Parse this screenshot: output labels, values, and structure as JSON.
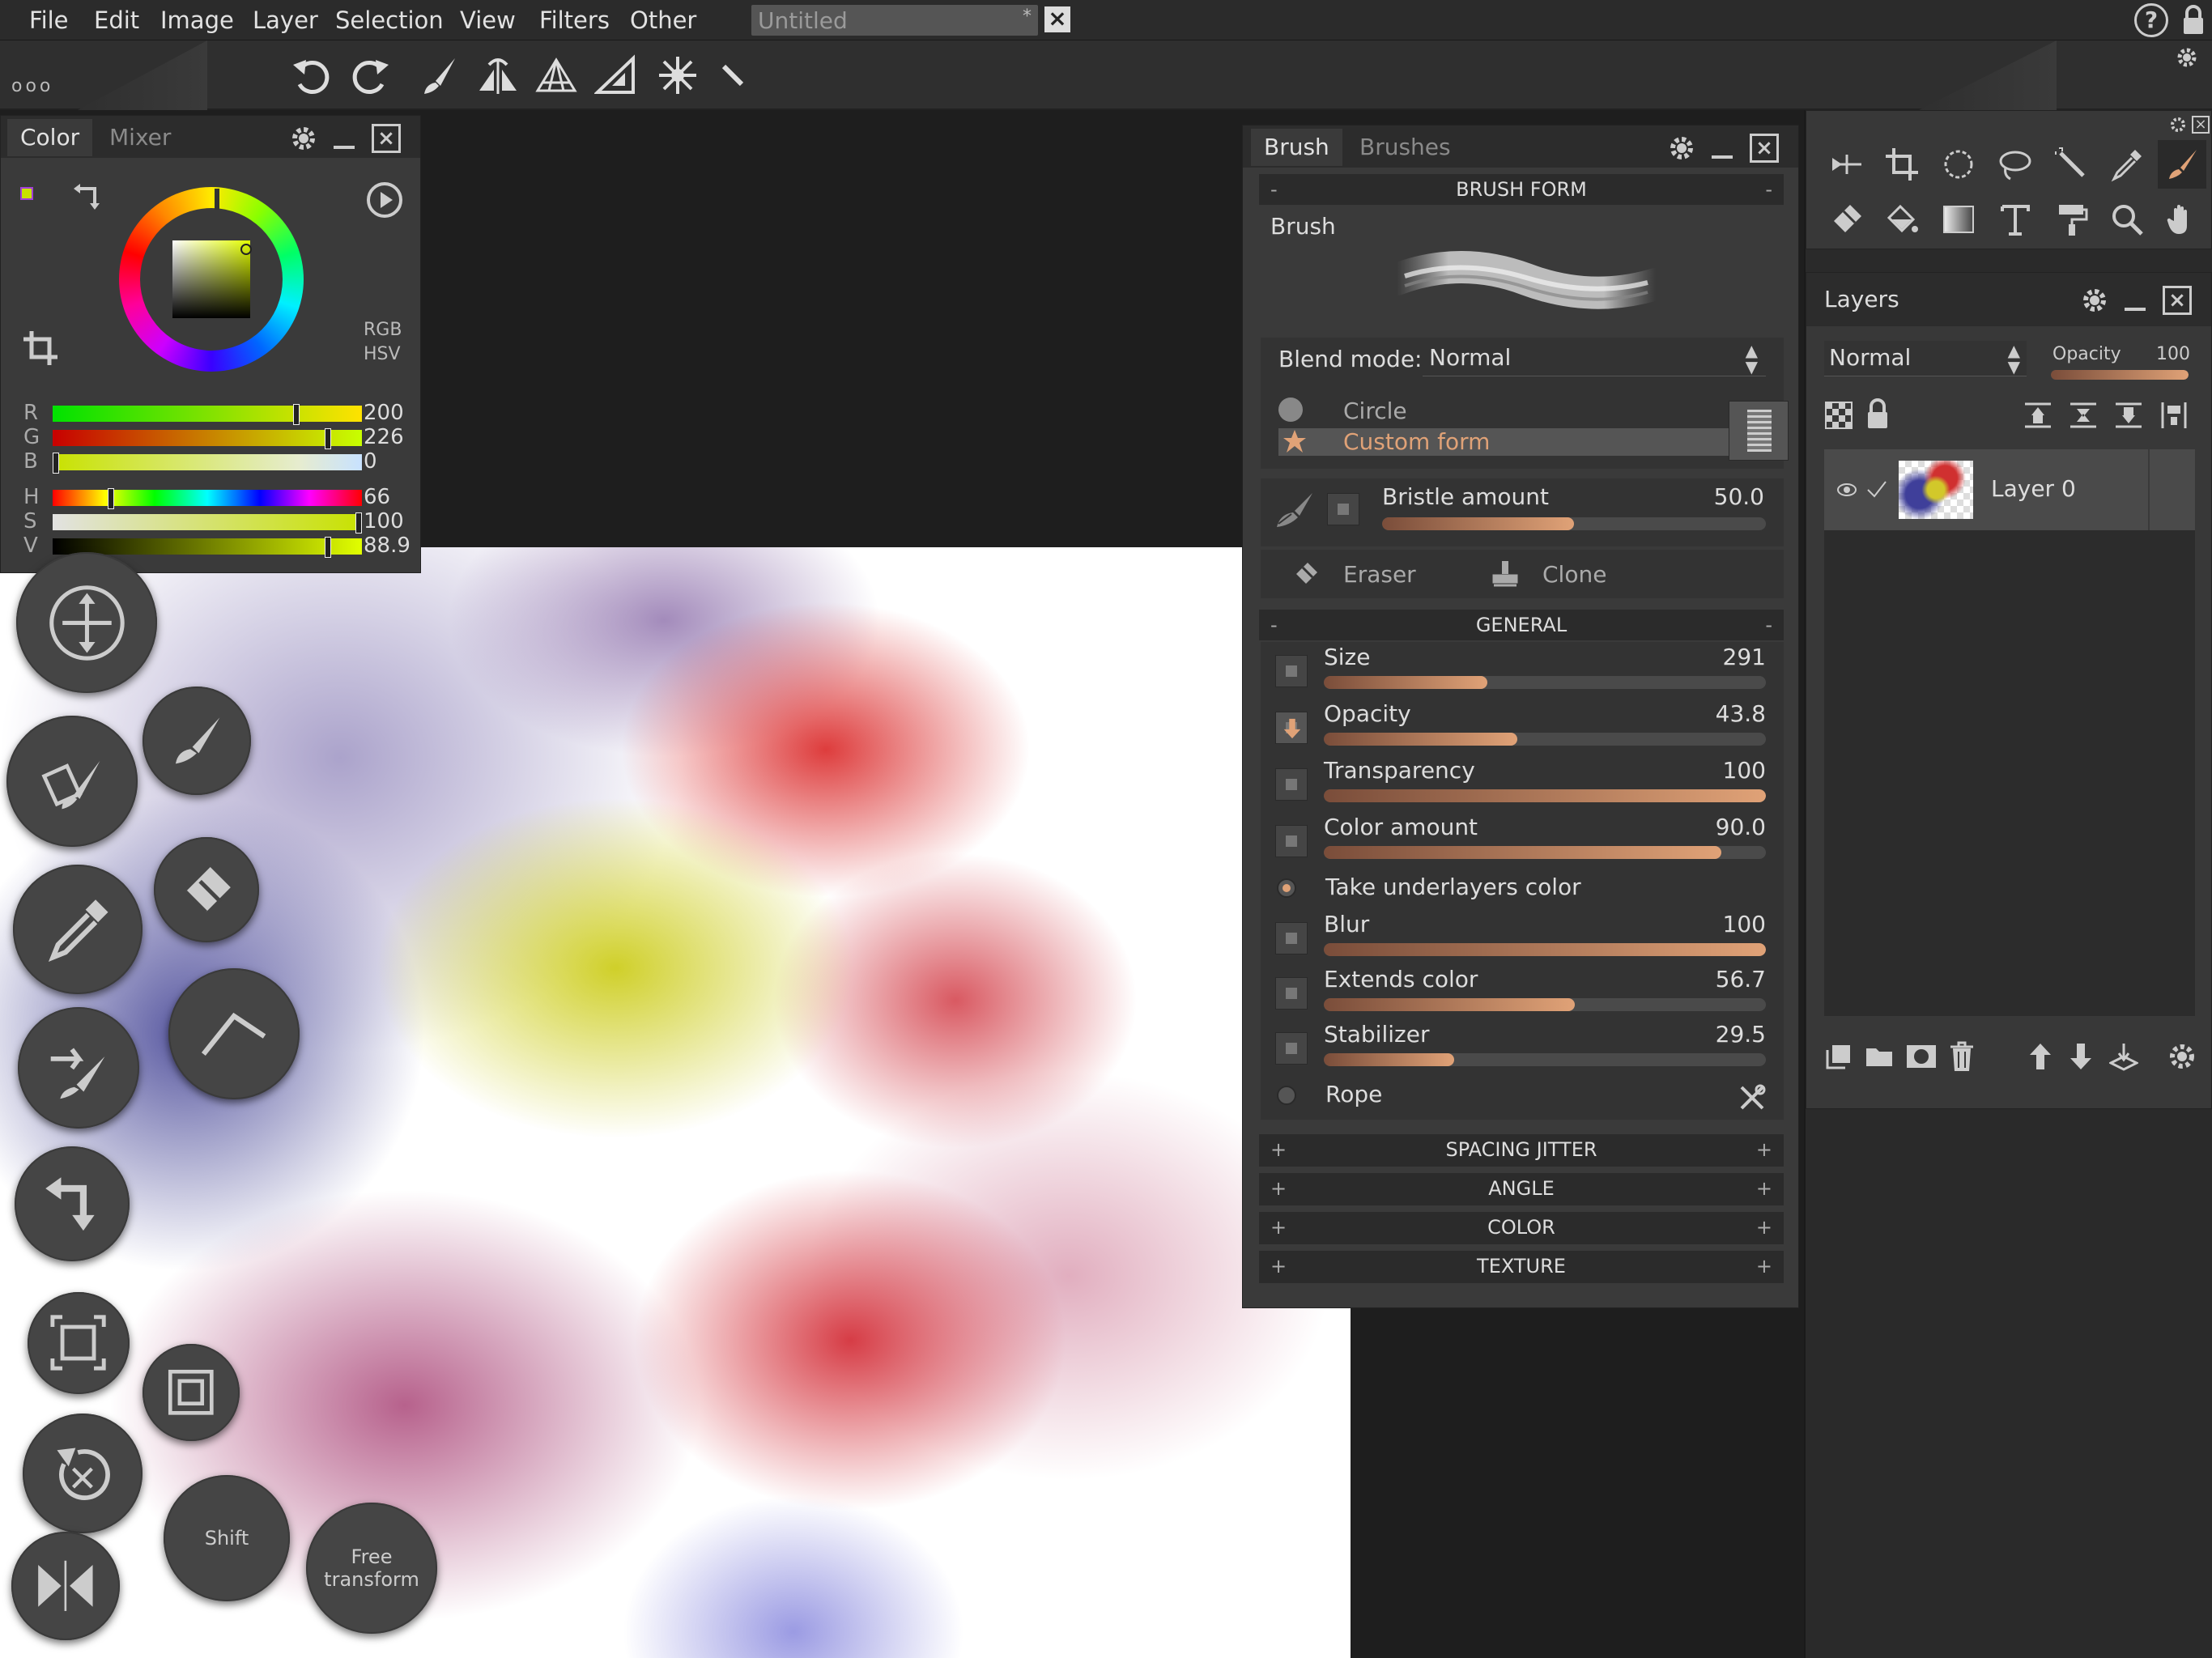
{
  "menu": {
    "items": [
      "File",
      "Edit",
      "Image",
      "Layer",
      "Selection",
      "View",
      "Filters",
      "Other"
    ],
    "doc_title": "Untitled",
    "doc_modified": "*"
  },
  "toolbar": {
    "more_label": "ooo",
    "icons": [
      "undo-icon",
      "redo-icon",
      "brush-icon",
      "symmetry-icon",
      "perspective-icon",
      "ruler-icon",
      "mandala-icon",
      "straight-line-icon"
    ]
  },
  "color_panel": {
    "tabs": [
      "Color",
      "Mixer"
    ],
    "mode_rgb": "RGB",
    "mode_hsv": "HSV",
    "sliders": [
      {
        "label": "R",
        "value": "200",
        "fill": 0.784
      },
      {
        "label": "G",
        "value": "226",
        "fill": 0.886
      },
      {
        "label": "B",
        "value": "0",
        "fill": 0.0
      },
      {
        "label": "H",
        "value": "66",
        "fill": 0.183
      },
      {
        "label": "S",
        "value": "100",
        "fill": 1.0
      },
      {
        "label": "V",
        "value": "88.9",
        "fill": 0.889
      }
    ],
    "current_color": "#c8e200"
  },
  "brush_panel": {
    "tabs": [
      "Brush",
      "Brushes"
    ],
    "brush_form_header": "BRUSH FORM",
    "brush_label": "Brush",
    "blend_mode_label": "Blend mode:",
    "blend_mode_value": "Normal",
    "form_circle": "Circle",
    "form_custom": "Custom form",
    "bristle_label": "Bristle amount",
    "bristle_value": "50.0",
    "bristle_fill": 0.5,
    "eraser_label": "Eraser",
    "clone_label": "Clone",
    "general_header": "GENERAL",
    "general": [
      {
        "label": "Size",
        "value": "291",
        "fill": 0.37
      },
      {
        "label": "Opacity",
        "value": "43.8",
        "fill": 0.438
      },
      {
        "label": "Transparency",
        "value": "100",
        "fill": 1.0
      },
      {
        "label": "Color amount",
        "value": "90.0",
        "fill": 0.9
      },
      {
        "label": "Blur",
        "value": "100",
        "fill": 1.0
      },
      {
        "label": "Extends color",
        "value": "56.7",
        "fill": 0.567
      },
      {
        "label": "Stabilizer",
        "value": "29.5",
        "fill": 0.295
      }
    ],
    "take_underlayers": "Take underlayers color",
    "rope": "Rope",
    "collapsed_sections": [
      "SPACING JITTER",
      "ANGLE",
      "COLOR",
      "TEXTURE"
    ],
    "accent_color": "#e0a277"
  },
  "layers_panel": {
    "title": "Layers",
    "blend_value": "Normal",
    "opacity_label": "Opacity",
    "opacity_value": "100",
    "opacity_fill": 1.0,
    "layers": [
      {
        "name": "Layer 0",
        "visible": true,
        "checked": true
      }
    ]
  },
  "canvas_buttons": {
    "shift_label": "Shift",
    "free_transform_label": "Free transform"
  }
}
